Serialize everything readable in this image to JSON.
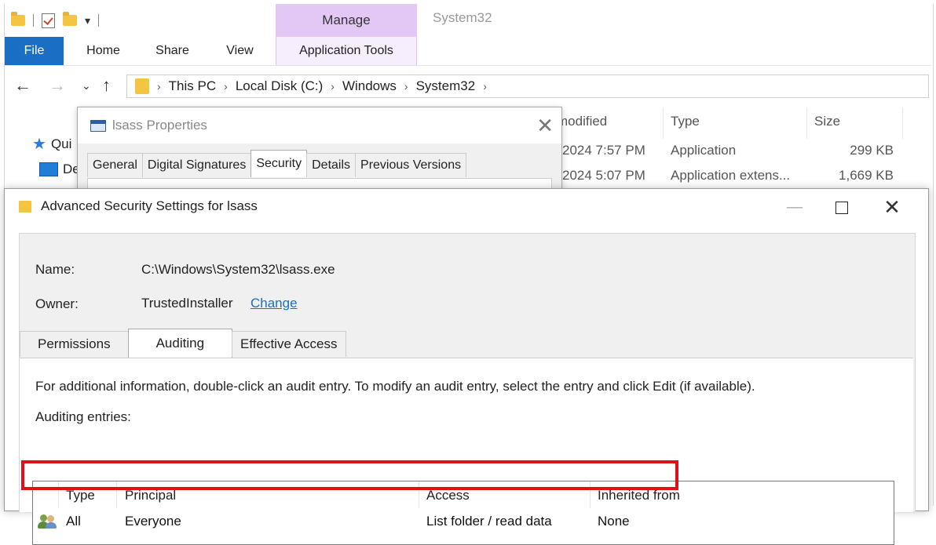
{
  "explorer": {
    "manage_tab": "Manage",
    "window_title": "System32",
    "ribbon_tabs": [
      "File",
      "Home",
      "Share",
      "View",
      "Application Tools"
    ],
    "breadcrumb": [
      "This PC",
      "Local Disk (C:)",
      "Windows",
      "System32"
    ],
    "nav_items": [
      "Qui",
      "De"
    ],
    "columns": {
      "modified": "modified",
      "type": "Type",
      "size": "Size"
    },
    "rows": [
      {
        "modified": "2024 7:57 PM",
        "type": "Application",
        "size": "299 KB"
      },
      {
        "modified": "2024 5:07 PM",
        "type": "Application extens...",
        "size": "1,669 KB"
      }
    ]
  },
  "properties": {
    "title": "lsass Properties",
    "tabs": [
      "General",
      "Digital Signatures",
      "Security",
      "Details",
      "Previous Versions"
    ],
    "active_tab": "Security"
  },
  "advanced": {
    "title": "Advanced Security Settings for lsass",
    "name_label": "Name:",
    "name_value": "C:\\Windows\\System32\\lsass.exe",
    "owner_label": "Owner:",
    "owner_value": "TrustedInstaller",
    "change_link": "Change",
    "tabs": [
      "Permissions",
      "Auditing",
      "Effective Access"
    ],
    "active_tab": "Auditing",
    "info_text": "For additional information, double-click an audit entry. To modify an audit entry, select the entry and click Edit (if available).",
    "entries_label": "Auditing entries:",
    "table": {
      "headers": [
        "Type",
        "Principal",
        "Access",
        "Inherited from"
      ],
      "rows": [
        {
          "type": "All",
          "principal": "Everyone",
          "access": "List folder / read data",
          "inherited": "None"
        }
      ]
    },
    "highlight_color": "#e0101a"
  }
}
